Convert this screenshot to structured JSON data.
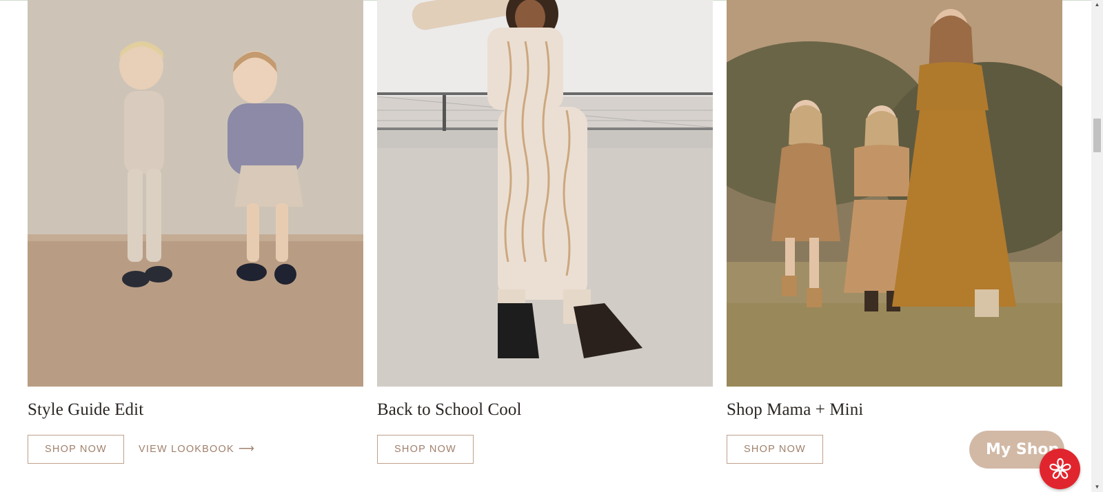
{
  "cards": [
    {
      "title": "Style Guide Edit",
      "primary_button": "SHOP NOW",
      "secondary_link": "VIEW LOOKBOOK",
      "secondary_arrow": "⟶"
    },
    {
      "title": "Back to School Cool",
      "primary_button": "SHOP NOW"
    },
    {
      "title": "Shop Mama + Mini",
      "primary_button": "SHOP NOW"
    }
  ],
  "floating": {
    "my_shop_label": "My Shop",
    "flower_icon": "flower-icon"
  },
  "colors": {
    "accent": "#a0806c",
    "button_border": "#bf9f8a",
    "my_shop_bg": "#d2b9a6",
    "flower_bg": "#e1252e",
    "title": "#2b2623"
  },
  "scrollbar": {
    "up_glyph": "▲",
    "down_glyph": "▼"
  }
}
